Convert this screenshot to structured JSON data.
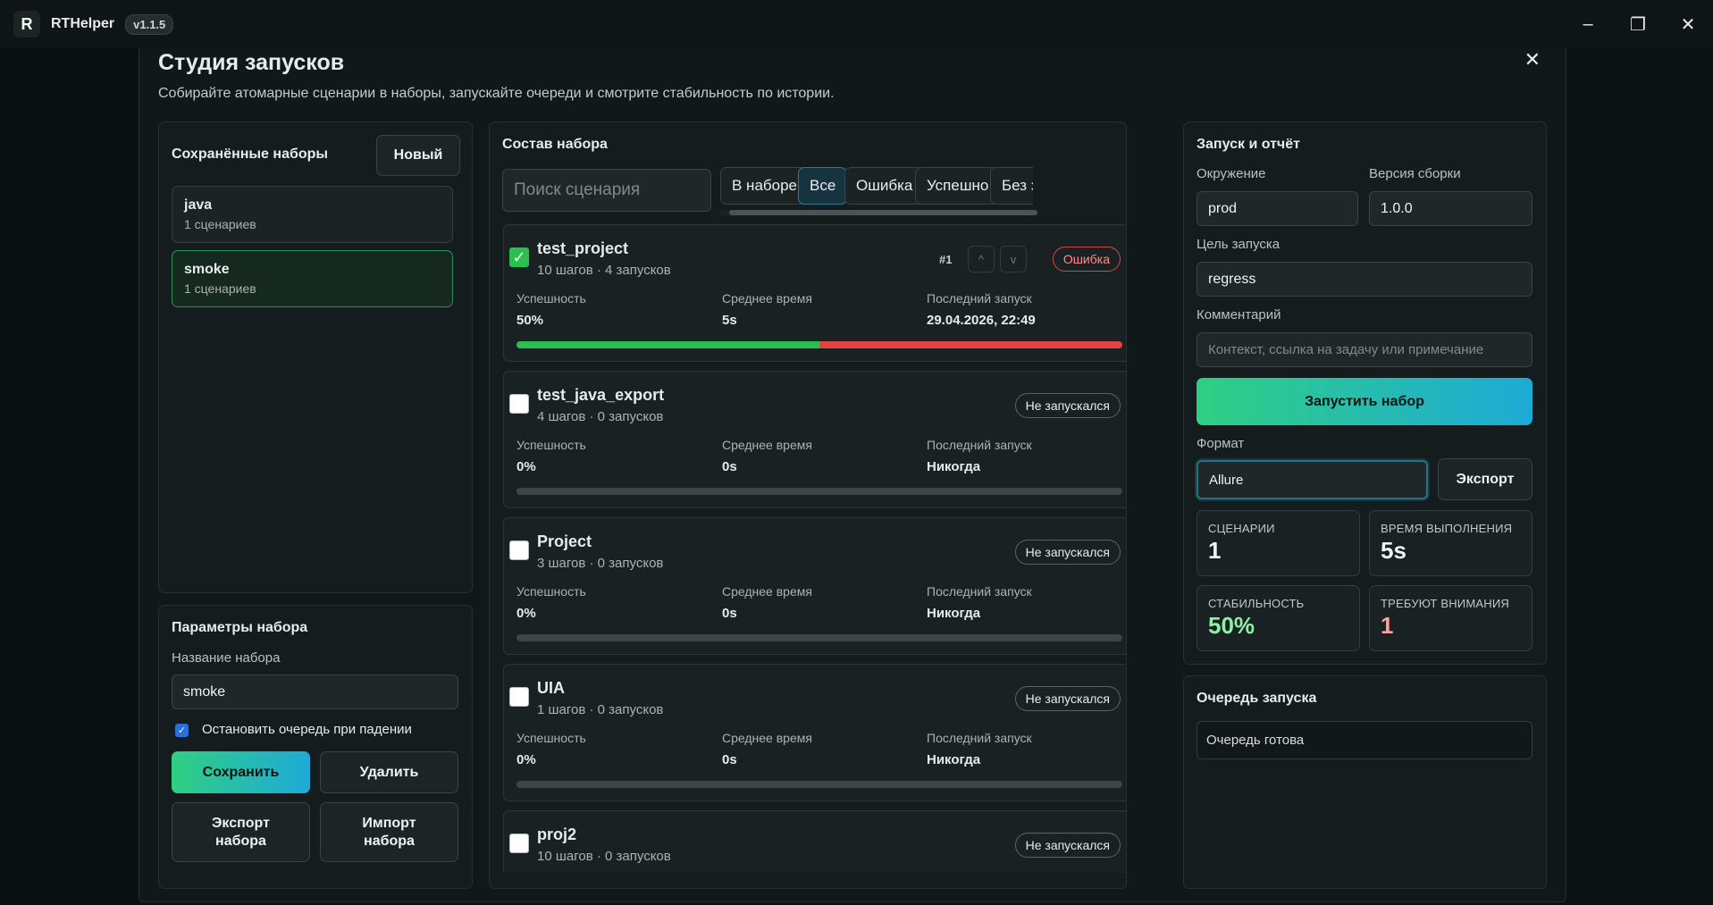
{
  "titlebar": {
    "app_name": "RTHelper",
    "version": "v1.1.5",
    "logo_letter": "R"
  },
  "window_controls": {
    "minimize": "–",
    "maximize": "❐",
    "close": "✕"
  },
  "modal": {
    "title": "Студия запусков",
    "subtitle": "Собирайте атомарные сценарии в наборы, запускайте очереди и смотрите стабильность по истории.",
    "close": "✕"
  },
  "saved_sets": {
    "title": "Сохранённые наборы",
    "new_button": "Новый",
    "items": [
      {
        "name": "java",
        "sub": "1 сценариев",
        "active": false
      },
      {
        "name": "smoke",
        "sub": "1 сценариев",
        "active": true
      }
    ]
  },
  "set_params": {
    "title": "Параметры набора",
    "name_label": "Название набора",
    "name_value": "smoke",
    "stop_label": "Остановить очередь при падении",
    "stop_checked": true,
    "save": "Сохранить",
    "delete": "Удалить",
    "export_line1": "Экспорт",
    "export_line2": "набора",
    "import_line1": "Импорт",
    "import_line2": "набора"
  },
  "composition": {
    "title": "Состав набора",
    "search_placeholder": "Поиск сценария",
    "filters": [
      "В наборе",
      "Все",
      "Ошибка",
      "Успешно",
      "Без за"
    ],
    "active_filter": 1,
    "stat_labels": {
      "success": "Успешность",
      "avg": "Среднее время",
      "last": "Последний запуск"
    },
    "scenarios": [
      {
        "name": "test_project",
        "meta": "10 шагов · 4 запусков",
        "status": "Ошибка",
        "checked": true,
        "success": "50%",
        "avg": "5s",
        "last": "29.04.2026, 22:49",
        "success_ratio": 0.5,
        "fail_ratio": 0.5,
        "order": "#1",
        "up": "^",
        "down": "v"
      },
      {
        "name": "test_java_export",
        "meta": "4 шагов · 0 запусков",
        "status": "Не запускался",
        "checked": false,
        "success": "0%",
        "avg": "0s",
        "last": "Никогда",
        "success_ratio": 0,
        "fail_ratio": 0
      },
      {
        "name": "Project",
        "meta": "3 шагов · 0 запусков",
        "status": "Не запускался",
        "checked": false,
        "success": "0%",
        "avg": "0s",
        "last": "Никогда",
        "success_ratio": 0,
        "fail_ratio": 0
      },
      {
        "name": "UIA",
        "meta": "1 шагов · 0 запусков",
        "status": "Не запускался",
        "checked": false,
        "success": "0%",
        "avg": "0s",
        "last": "Никогда",
        "success_ratio": 0,
        "fail_ratio": 0
      },
      {
        "name": "proj2",
        "meta": "10 шагов · 0 запусков",
        "status": "Не запускался",
        "checked": false
      }
    ]
  },
  "launch": {
    "title": "Запуск и отчёт",
    "env_label": "Окружение",
    "env_value": "prod",
    "build_label": "Версия сборки",
    "build_value": "1.0.0",
    "goal_label": "Цель запуска",
    "goal_value": "regress",
    "comment_label": "Комментарий",
    "comment_placeholder": "Контекст, ссылка на задачу или примечание",
    "run_button": "Запустить набор",
    "format_label": "Формат",
    "format_value": "Allure",
    "export_button": "Экспорт",
    "metrics": [
      {
        "label": "СЦЕНАРИИ",
        "value": "1",
        "color": "#f0f4f4"
      },
      {
        "label": "ВРЕМЯ ВЫПОЛНЕНИЯ",
        "value": "5s",
        "color": "#f0f4f4"
      },
      {
        "label": "СТАБИЛЬНОСТЬ",
        "value": "50%",
        "color": "#8ef0a8"
      },
      {
        "label": "ТРЕБУЮТ ВНИМАНИЯ",
        "value": "1",
        "color": "#ff9f9f"
      }
    ]
  },
  "queue": {
    "title": "Очередь запуска",
    "status": "Очередь готова"
  }
}
